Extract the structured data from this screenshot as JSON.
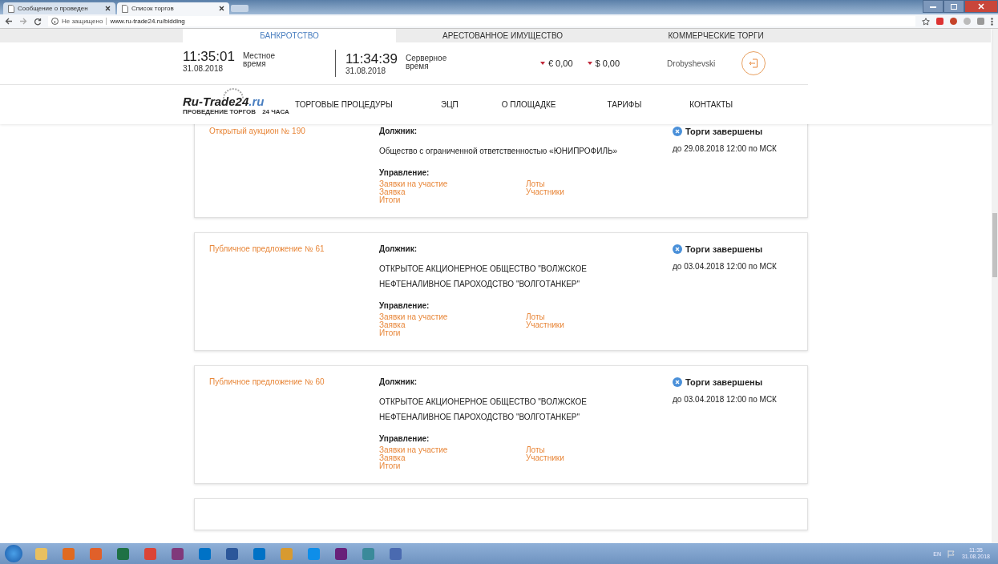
{
  "browser": {
    "tabs": [
      {
        "title": "Сообщение о проведен",
        "selected": false
      },
      {
        "title": "Список торгов",
        "selected": true
      }
    ],
    "address": {
      "security": "Не защищено",
      "url": "www.ru-trade24.ru/bidding"
    }
  },
  "site_tabs": [
    {
      "label": "БАНКРОТСТВО",
      "selected": true
    },
    {
      "label": "АРЕСТОВАННОЕ ИМУЩЕСТВО",
      "selected": false
    },
    {
      "label": "КОММЕРЧЕСКИЕ ТОРГИ",
      "selected": false
    }
  ],
  "clocks": [
    {
      "time": "11:35:01",
      "date": "31.08.2018",
      "label": "Местное время"
    },
    {
      "time": "11:34:39",
      "date": "31.08.2018",
      "label": "Серверное время"
    }
  ],
  "currencies": [
    {
      "value": "€ 0,00"
    },
    {
      "value": "$ 0,00"
    }
  ],
  "user": "Drobyshevski",
  "logo": {
    "name": "Ru-Trade24",
    "domain": ".ru",
    "tagline_left": "ПРОВЕДЕНИЕ ТОРГОВ",
    "tagline_right": "24 ЧАСА"
  },
  "nav": [
    "ТОРГОВЫЕ ПРОЦЕДУРЫ",
    "ЭЦП",
    "О ПЛОЩАДКЕ",
    "ТАРИФЫ",
    "КОНТАКТЫ"
  ],
  "cards": [
    {
      "title": "Открытый аукцион № 190",
      "debtor_label": "Должник:",
      "debtor": "Общество с ограниченной ответственностью «ЮНИПРОФИЛЬ»",
      "management_label": "Управление:",
      "links_left": [
        "Заявки на участие",
        "Заявка",
        "Итоги"
      ],
      "links_right": [
        "Лоты",
        "Участники"
      ],
      "status": "Торги завершены",
      "deadline": "до 29.08.2018 12:00 по МСК"
    },
    {
      "title": "Публичное предложение № 61",
      "debtor_label": "Должник:",
      "debtor": "ОТКРЫТОЕ АКЦИОНЕРНОЕ ОБЩЕСТВО \"ВОЛЖСКОЕ НЕФТЕНАЛИВНОЕ ПАРОХОДСТВО \"ВОЛГОТАНКЕР\"",
      "management_label": "Управление:",
      "links_left": [
        "Заявки на участие",
        "Заявка",
        "Итоги"
      ],
      "links_right": [
        "Лоты",
        "Участники"
      ],
      "status": "Торги завершены",
      "deadline": "до 03.04.2018 12:00 по МСК"
    },
    {
      "title": "Публичное предложение № 60",
      "debtor_label": "Должник:",
      "debtor": "ОТКРЫТОЕ АКЦИОНЕРНОЕ ОБЩЕСТВО \"ВОЛЖСКОЕ НЕФТЕНАЛИВНОЕ ПАРОХОДСТВО \"ВОЛГОТАНКЕР\"",
      "management_label": "Управление:",
      "links_left": [
        "Заявки на участие",
        "Заявка",
        "Итоги"
      ],
      "links_right": [
        "Лоты",
        "Участники"
      ],
      "status": "Торги завершены",
      "deadline": "до 03.04.2018 12:00 по МСК"
    }
  ],
  "taskbar": {
    "language": "EN",
    "time": "11:35",
    "date": "31.08.2018"
  }
}
